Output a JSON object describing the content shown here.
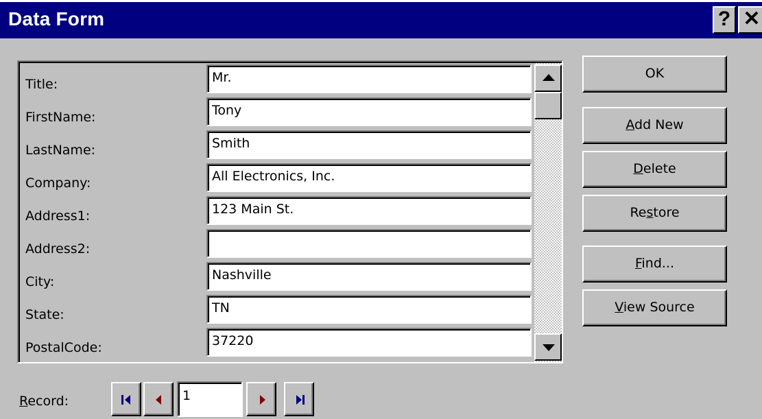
{
  "window": {
    "title": "Data Form",
    "help_glyph": "?",
    "close_glyph": "✕"
  },
  "fields": [
    {
      "label": "Title:",
      "value": "Mr."
    },
    {
      "label": "FirstName:",
      "value": "Tony"
    },
    {
      "label": "LastName:",
      "value": "Smith"
    },
    {
      "label": "Company:",
      "value": "All Electronics, Inc."
    },
    {
      "label": "Address1:",
      "value": "123 Main St."
    },
    {
      "label": "Address2:",
      "value": ""
    },
    {
      "label": "City:",
      "value": "Nashville"
    },
    {
      "label": "State:",
      "value": "TN"
    },
    {
      "label": "PostalCode:",
      "value": "37220"
    }
  ],
  "buttons": {
    "ok": "OK",
    "add_new": {
      "mnemonic": "A",
      "rest": "dd New"
    },
    "delete": {
      "mnemonic": "D",
      "rest": "elete"
    },
    "restore": {
      "pre": "Re",
      "mnemonic": "s",
      "rest": "tore"
    },
    "find": {
      "mnemonic": "F",
      "rest": "ind..."
    },
    "view_source": {
      "mnemonic": "V",
      "rest": "iew Source"
    }
  },
  "record": {
    "mnemonic": "R",
    "rest": "ecord:",
    "current": "1"
  },
  "icons": {
    "help": "question-mark-icon",
    "close": "close-icon",
    "scroll_up": "triangle-up-icon",
    "scroll_down": "triangle-down-icon",
    "first": "first-record-icon",
    "prev": "previous-record-icon",
    "next": "next-record-icon",
    "last": "last-record-icon"
  },
  "colors": {
    "titlebar": "#000080",
    "face": "#c0c0c0",
    "nav_arrow": "#800000",
    "nav_endbar": "#000080"
  }
}
